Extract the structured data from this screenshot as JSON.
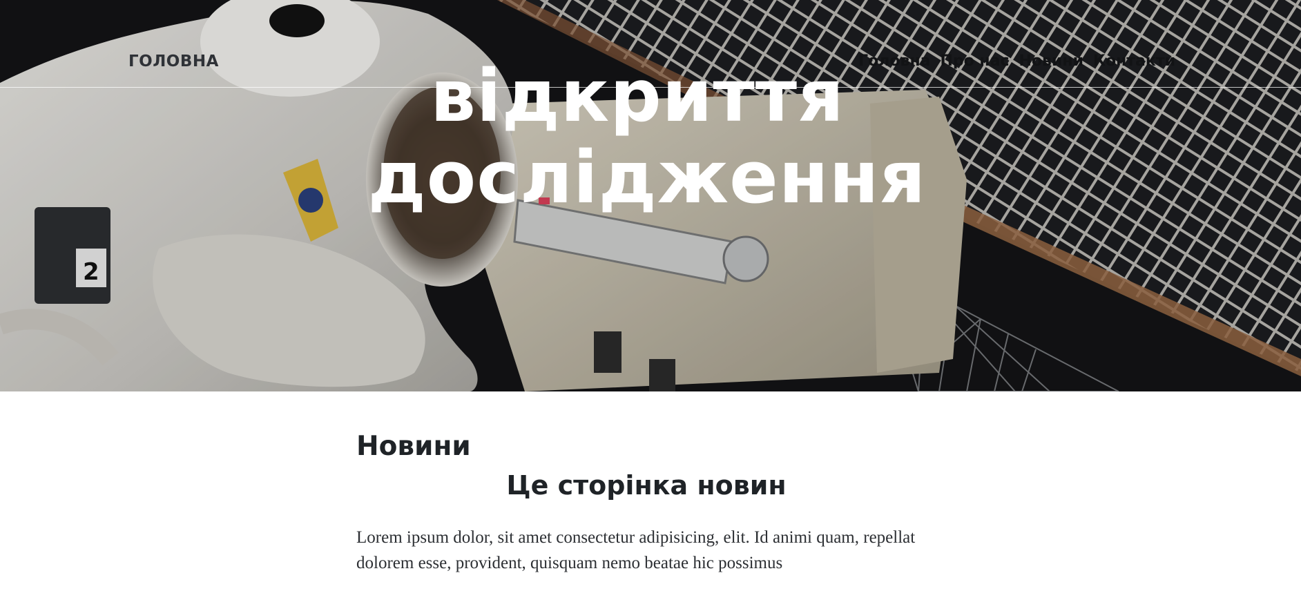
{
  "header": {
    "brand": "ГОЛОВНА",
    "nav": [
      {
        "label": "Головна"
      },
      {
        "label": "Про нас"
      },
      {
        "label": "Новини"
      },
      {
        "label": "Контакти"
      }
    ]
  },
  "hero": {
    "title_line1": "відкриття",
    "title_line2": "дослідження",
    "image_subject": "astronaut-spacewalk-photo"
  },
  "main": {
    "section_title": "Новини",
    "subtitle": "Це сторінка новин",
    "body": "Lorem ipsum dolor, sit amet consectetur adipisicing, elit. Id animi quam, repellat dolorem esse, provident, quisquam nemo beatae hic possimus"
  },
  "colors": {
    "hero_overlay": "#000000",
    "nav_text": "#121315",
    "brand_text": "#2f3237",
    "heading_text": "#1f2327",
    "body_text": "#2c2f33"
  }
}
